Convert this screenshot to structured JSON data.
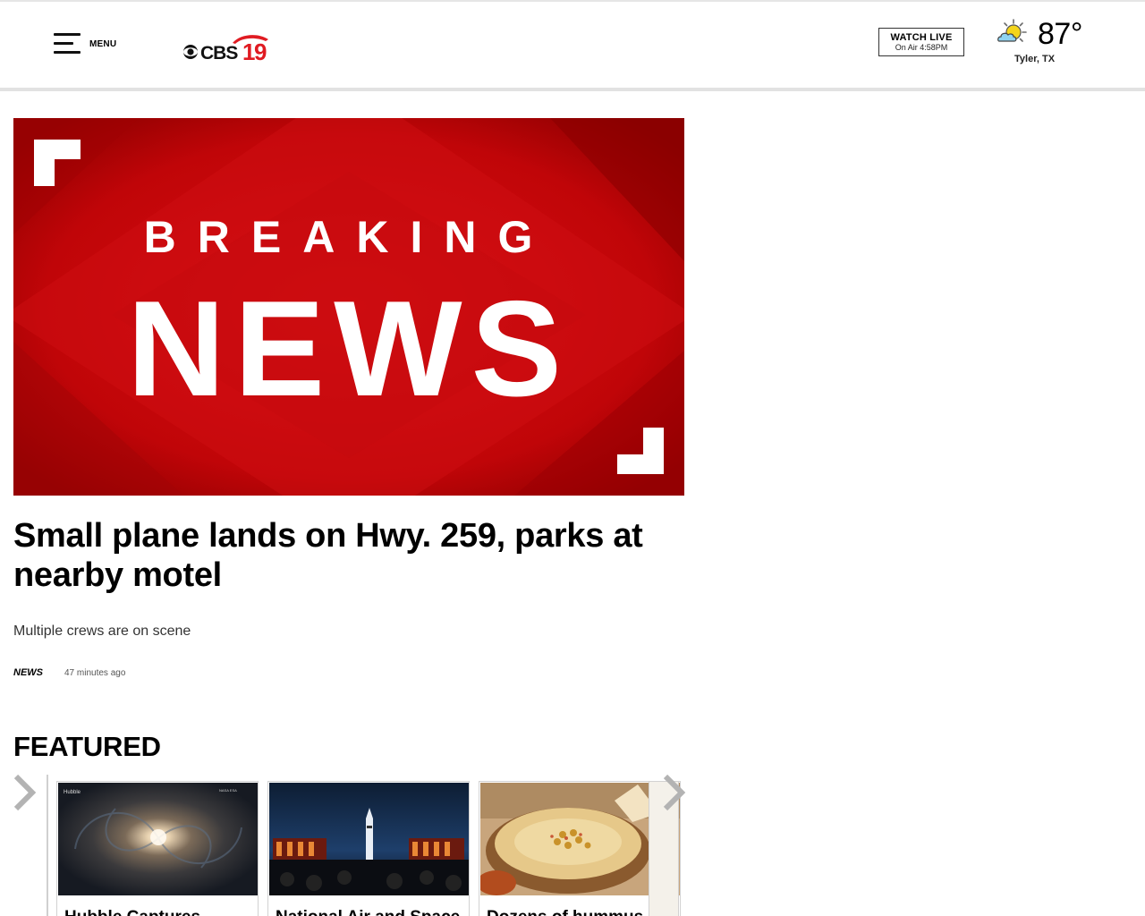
{
  "header": {
    "menu_label": "MENU",
    "logo_text": "CBS19",
    "watch_live": {
      "title": "WATCH LIVE",
      "subtitle": "On Air 4:58PM"
    },
    "weather": {
      "icon": "partly-sunny-icon",
      "temperature": "87°",
      "location": "Tyler, TX"
    }
  },
  "hero": {
    "image_text_top": "BREAKING",
    "image_text_main": "NEWS",
    "headline": "Small plane lands on Hwy. 259, parks at nearby motel",
    "subhead": "Multiple crews are on scene",
    "category": "NEWS",
    "timestamp": "47 minutes ago"
  },
  "featured": {
    "title": "FEATURED",
    "cards": [
      {
        "title": "Hubble Captures"
      },
      {
        "title": "National Air and Space"
      },
      {
        "title": "Dozens of hummus"
      }
    ]
  },
  "colors": {
    "breaking_red": "#c8080c",
    "breaking_dark": "#9a0000",
    "logo_red": "#e01b22",
    "weather_yellow": "#f4d51c",
    "text_primary": "#000000",
    "arrow_gray": "#b3b3b3"
  }
}
